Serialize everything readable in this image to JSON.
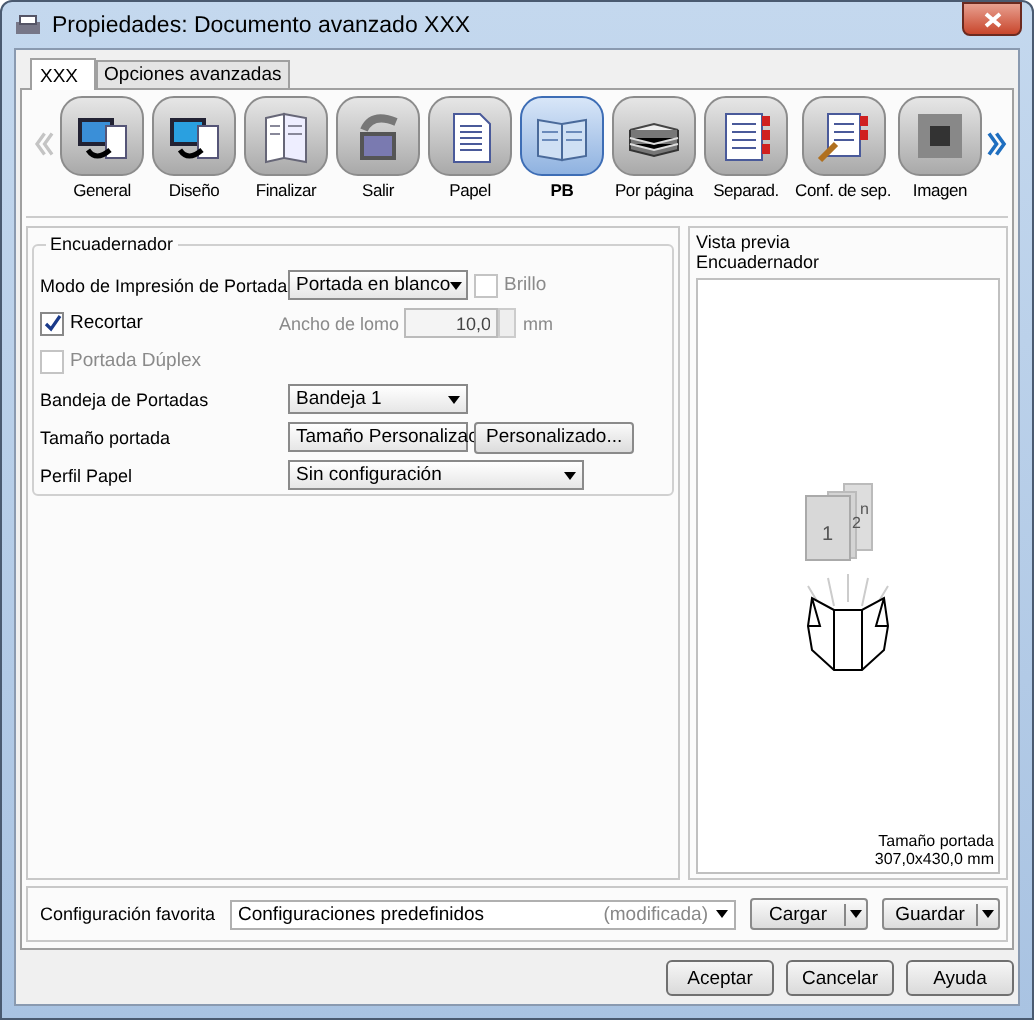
{
  "window": {
    "title": "Propiedades: Documento avanzado XXX"
  },
  "tabs": [
    {
      "label": "XXX",
      "selected": true
    },
    {
      "label": "Opciones avanzadas",
      "selected": false
    }
  ],
  "toolbar": {
    "items": [
      {
        "label": "General",
        "selected": false
      },
      {
        "label": "Diseño",
        "selected": false
      },
      {
        "label": "Finalizar",
        "selected": false
      },
      {
        "label": "Salir",
        "selected": false
      },
      {
        "label": "Papel",
        "selected": false
      },
      {
        "label": "PB",
        "selected": true
      },
      {
        "label": "Por página",
        "selected": false
      },
      {
        "label": "Separad.",
        "selected": false
      },
      {
        "label": "Conf. de sep.",
        "selected": false
      },
      {
        "label": "Imagen",
        "selected": false
      }
    ]
  },
  "binding": {
    "title": "Encuadernador",
    "print_mode": {
      "label": "Modo de Impresión de Portada",
      "value": "Portada en blanco"
    },
    "gloss": {
      "label": "Brillo",
      "checked": false,
      "disabled": true
    },
    "trim": {
      "label": "Recortar",
      "checked": true,
      "disabled": false
    },
    "spine_width": {
      "label": "Ancho de lomo",
      "value": "10,0",
      "unit": "mm",
      "disabled": true
    },
    "duplex_cover": {
      "label": "Portada Dúplex",
      "checked": false,
      "disabled": true
    },
    "cover_tray": {
      "label": "Bandeja de Portadas",
      "value": "Bandeja 1"
    },
    "cover_size": {
      "label": "Tamaño portada",
      "value": "Tamaño Personalizac",
      "button": "Personalizado..."
    },
    "paper_profile": {
      "label": "Perfil Papel",
      "value": "Sin configuración"
    }
  },
  "preview": {
    "title": "Vista previa",
    "subtitle": "Encuadernador",
    "page_labels": [
      "1",
      "2",
      "n"
    ],
    "size_label": "Tamaño portada",
    "size_value": "307,0x430,0 mm"
  },
  "favorite": {
    "label": "Configuración favorita",
    "value": "Configuraciones predefinidos",
    "status": "(modificada)",
    "load": "Cargar",
    "save": "Guardar"
  },
  "buttons": [
    "Aceptar",
    "Cancelar",
    "Ayuda"
  ]
}
